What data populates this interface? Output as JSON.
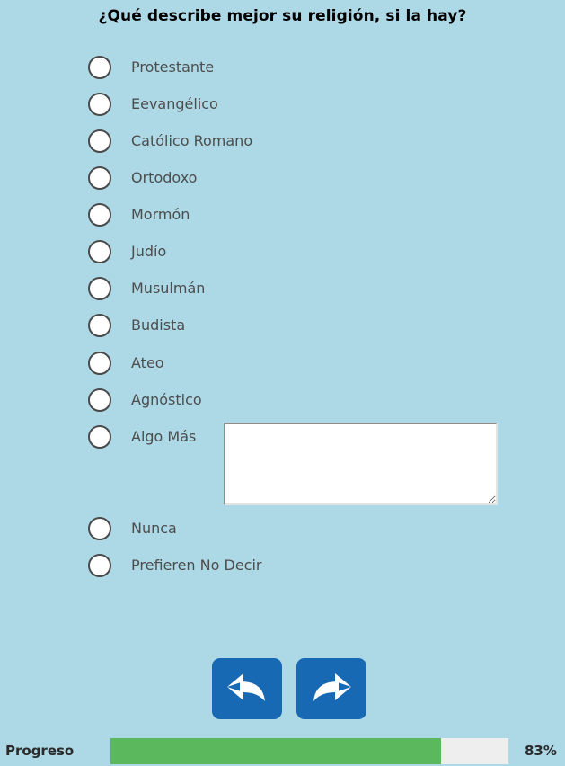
{
  "question": {
    "title": "¿Qué describe mejor su religión, si la hay?"
  },
  "options": [
    {
      "label": "Protestante"
    },
    {
      "label": "Eevangélico"
    },
    {
      "label": "Católico Romano"
    },
    {
      "label": "Ortodoxo"
    },
    {
      "label": "Mormón"
    },
    {
      "label": "Judío"
    },
    {
      "label": "Musulmán"
    },
    {
      "label": "Budista"
    },
    {
      "label": "Ateo"
    },
    {
      "label": "Agnóstico"
    },
    {
      "label": "Algo Más"
    },
    {
      "label": "Nunca"
    },
    {
      "label": "Prefieren No Decir"
    }
  ],
  "other_input": {
    "value": "",
    "placeholder": ""
  },
  "navigation": {
    "back_icon": "undo-arrow-icon",
    "next_icon": "redo-arrow-icon",
    "button_color": "#1769b4"
  },
  "progress": {
    "label": "Progreso",
    "percent_text": "83%",
    "fraction": 0.83,
    "fill_color": "#5cb85c"
  }
}
